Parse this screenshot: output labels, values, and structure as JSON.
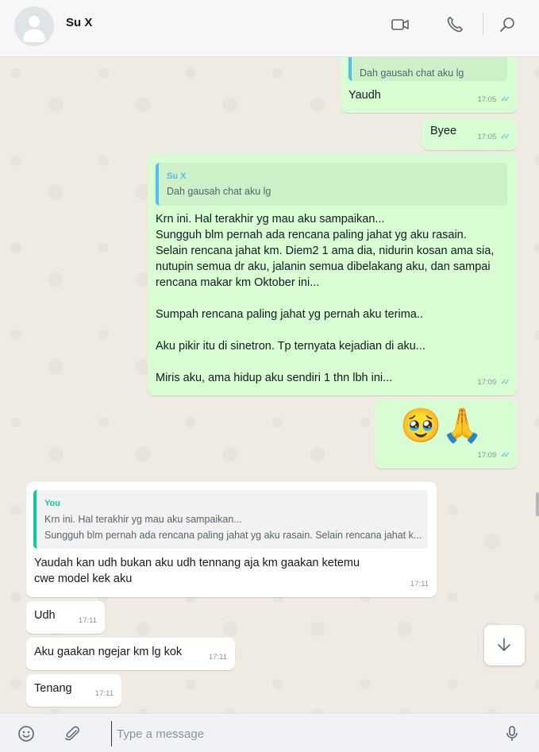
{
  "header": {
    "contact_name": "Su X"
  },
  "messages": [
    {
      "id": "m1",
      "direction": "out",
      "quote_text": "Dah gausah chat aku lg",
      "text": "Yaudh",
      "time": "17:05",
      "status": "read"
    },
    {
      "id": "m2",
      "direction": "out",
      "text": "Byee",
      "time": "17:05",
      "status": "read"
    },
    {
      "id": "m3",
      "direction": "out",
      "quote_name": "Su X",
      "quote_text": "Dah gausah chat aku lg",
      "text": "Krn ini.  Hal terakhir yg mau aku sampaikan...\nSungguh blm pernah ada rencana paling jahat yg aku rasain.\nSelain rencana jahat km. Diem2 1 ama dia, nidurin kosan ama sia,\nnutupin semua dr aku, jalanin semua dibelakang aku, dan sampai\nrencana makar km Oktober ini...\n\nSumpah rencana paling jahat yg pernah aku terima..\n\nAku pikir itu di sinetron. Tp ternyata kejadian di aku...\n\nMiris aku, ama hidup aku sendiri 1 thn lbh ini...",
      "time": "17:09",
      "status": "read"
    },
    {
      "id": "m4",
      "direction": "out",
      "emoji": "🥹🙏",
      "emoji_names": [
        "pleading-face-emoji",
        "folded-hands-emoji"
      ],
      "time": "17:09",
      "status": "read"
    },
    {
      "id": "m5",
      "direction": "in",
      "quote_name": "You",
      "quote_lines": [
        "Krn ini.  Hal terakhir yg mau aku sampaikan...",
        "Sungguh blm pernah ada rencana paling jahat yg aku rasain. Selain rencana jahat k..."
      ],
      "text": "Yaudah kan udh bukan aku udh tennang aja km gaakan ketemu\ncwe model kek aku",
      "time": "17:11"
    },
    {
      "id": "m6",
      "direction": "in",
      "text": "Udh",
      "time": "17:11"
    },
    {
      "id": "m7",
      "direction": "in",
      "text": "Aku gaakan ngejar km lg kok",
      "time": "17:11"
    },
    {
      "id": "m8",
      "direction": "in",
      "text": "Tenang",
      "time": "17:11"
    }
  ],
  "composer": {
    "placeholder": "Type a message"
  },
  "icons": {
    "video_call": "video-camera-icon",
    "voice_call": "phone-icon",
    "search": "search-icon",
    "emoji": "emoji-icon",
    "attach": "paperclip-icon",
    "mic": "microphone-icon",
    "scroll_down": "arrow-down-icon"
  },
  "colors": {
    "outgoing_bubble": "#d9fdd3",
    "incoming_bubble": "#ffffff",
    "read_ticks": "#53bdeb",
    "quote_self": "#06cf9c",
    "quote_contact": "#53bdeb",
    "chat_bg": "#efeae2"
  }
}
